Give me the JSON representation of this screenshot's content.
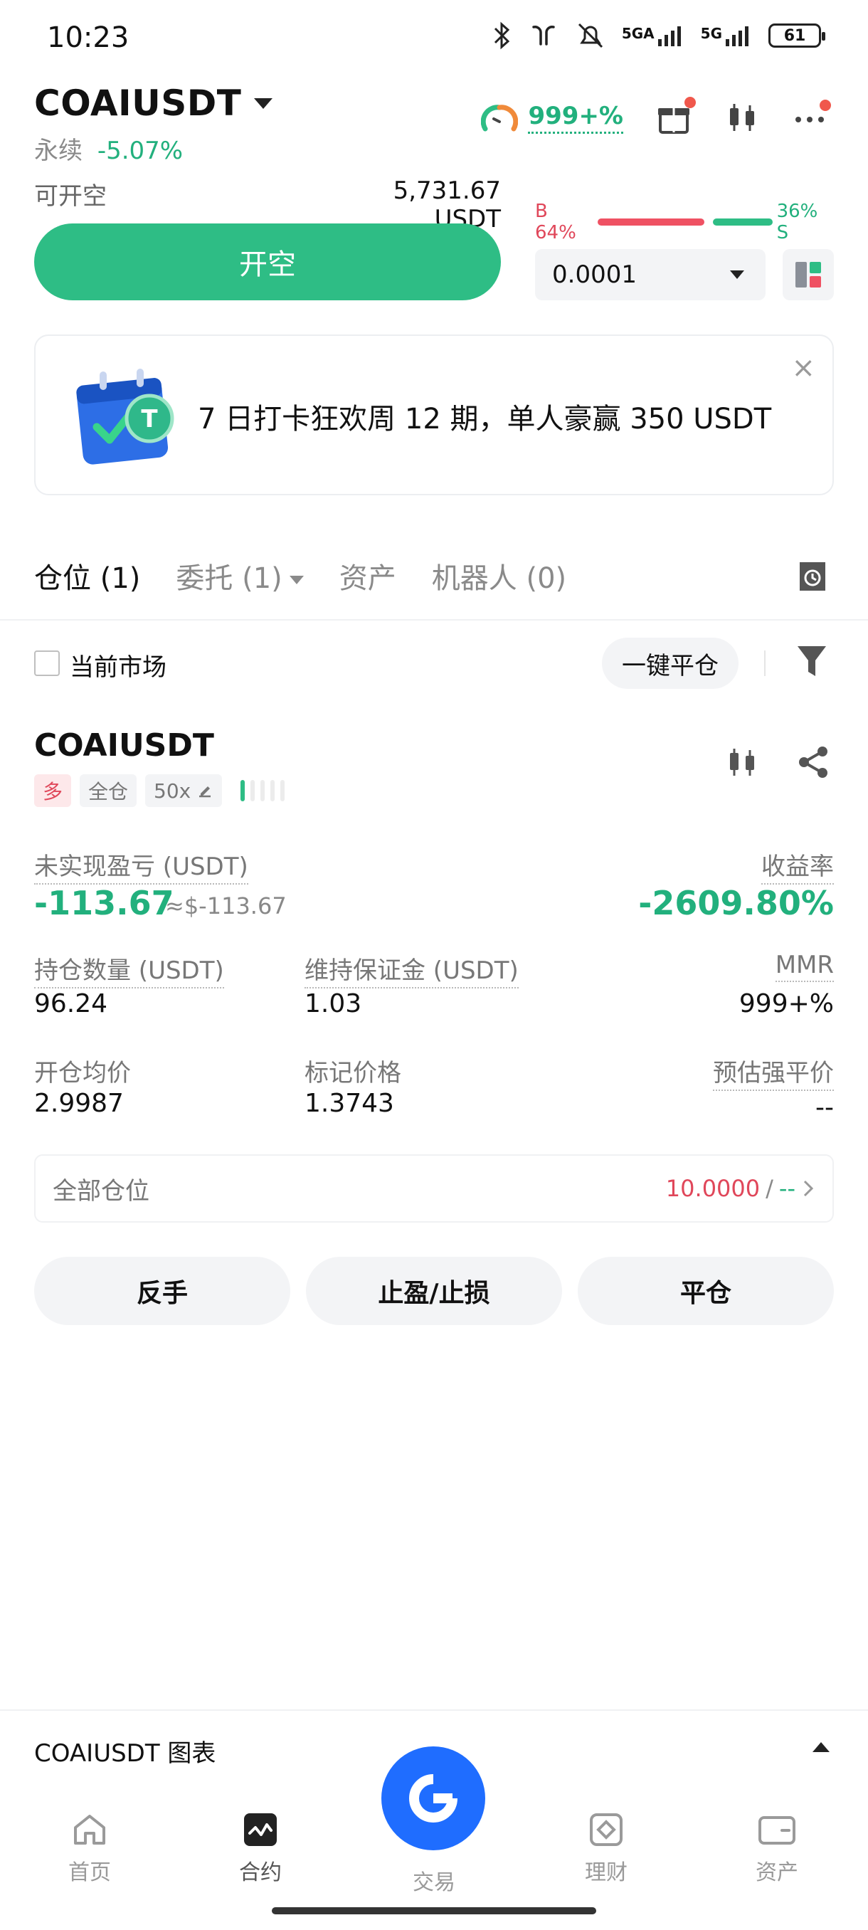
{
  "status_bar": {
    "time": "10:23",
    "net1": "5GA",
    "net2": "5G",
    "battery": "61"
  },
  "header": {
    "symbol": "COAIUSDT",
    "contract_type": "永续",
    "change": "-5.07%",
    "gauge_value": "999+%"
  },
  "open_short": {
    "available_label": "可开空",
    "available_value": "5,731.67 USDT",
    "button_label": "开空",
    "ratio_buy": "B 64%",
    "ratio_sell": "36% S",
    "ratio_buy_fraction": 0.64,
    "precision": "0.0001"
  },
  "banner": {
    "text": "7 日打卡狂欢周 12 期，单人豪赢 350 USDT",
    "close": "×"
  },
  "tabs": [
    {
      "label": "仓位 (1)"
    },
    {
      "label": "委托 (1)"
    },
    {
      "label": "资产"
    },
    {
      "label": "机器人 (0)"
    }
  ],
  "filter": {
    "current_market_label": "当前市场",
    "close_all_label": "一键平仓"
  },
  "position": {
    "symbol": "COAIUSDT",
    "side": "多",
    "margin_mode": "全仓",
    "leverage": "50x",
    "risk_level_fraction": 0.2,
    "pnl_label": "未实现盈亏 (USDT)",
    "pnl_value": "-113.67",
    "pnl_approx": "≈$-113.67",
    "roi_label": "收益率",
    "roi_value": "-2609.80%",
    "size_label": "持仓数量 (USDT)",
    "size_value": "96.24",
    "maint_label": "维持保证金 (USDT)",
    "maint_value": "1.03",
    "mmr_label": "MMR",
    "mmr_value": "999+%",
    "entry_label": "开仓均价",
    "entry_value": "2.9987",
    "mark_label": "标记价格",
    "mark_value": "1.3743",
    "liq_label": "预估强平价",
    "liq_value": "--",
    "all_positions_label": "全部仓位",
    "all_positions_red": "10.0000",
    "all_positions_sep": " / ",
    "all_positions_green": "--",
    "actions": {
      "reverse": "反手",
      "tpsl": "止盈/止损",
      "close": "平仓"
    }
  },
  "chart_bar": {
    "label": "COAIUSDT 图表"
  },
  "nav": {
    "home": "首页",
    "contract": "合约",
    "trade": "交易",
    "earn": "理财",
    "assets": "资产"
  },
  "colors": {
    "green": "#2ebd85",
    "red": "#ef5163",
    "blue": "#1f6dff"
  }
}
